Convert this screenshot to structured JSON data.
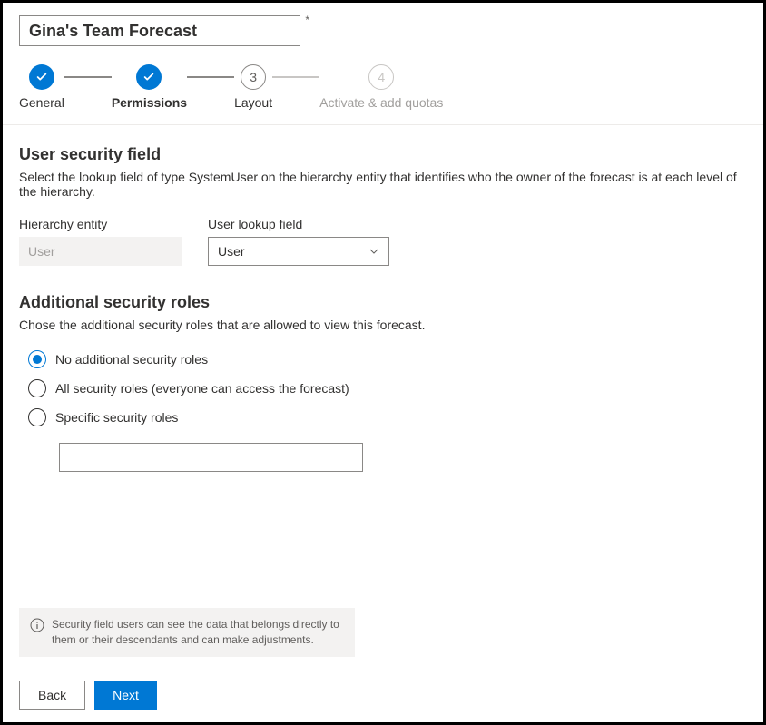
{
  "title_value": "Gina's Team Forecast",
  "required_mark": "*",
  "stepper": {
    "steps": [
      {
        "label": "General"
      },
      {
        "label": "Permissions"
      },
      {
        "num": "3",
        "label": "Layout"
      },
      {
        "num": "4",
        "label": "Activate & add quotas"
      }
    ]
  },
  "user_security": {
    "title": "User security field",
    "desc": "Select the lookup field of type SystemUser on the hierarchy entity that identifies who the owner of the forecast is at each level of the hierarchy.",
    "hierarchy_label": "Hierarchy entity",
    "hierarchy_value": "User",
    "lookup_label": "User lookup field",
    "lookup_value": "User"
  },
  "additional_roles": {
    "title": "Additional security roles",
    "desc": "Chose the additional security roles that are allowed to view this forecast.",
    "options": [
      "No additional security roles",
      "All security roles (everyone can access the forecast)",
      "Specific security roles"
    ]
  },
  "info_text": "Security field users can see the data that belongs directly to them or their descendants and can make adjustments.",
  "buttons": {
    "back": "Back",
    "next": "Next"
  }
}
